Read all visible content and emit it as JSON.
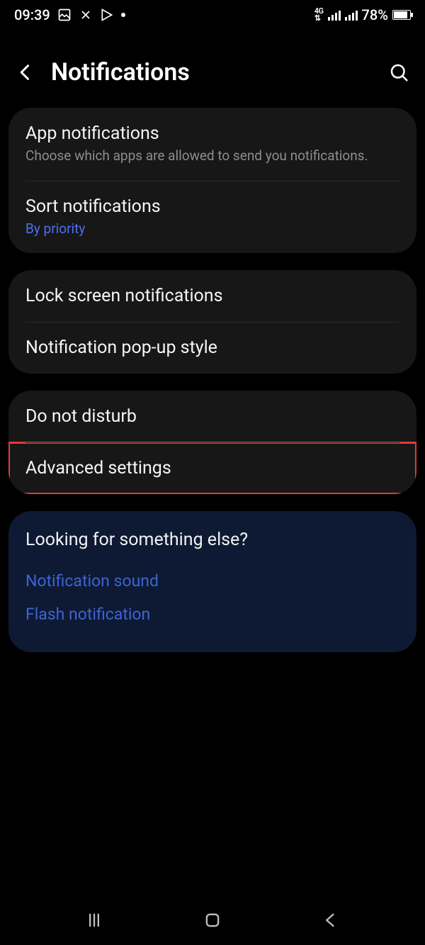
{
  "status": {
    "time": "09:39",
    "network_label": "4G",
    "battery_text": "78%"
  },
  "header": {
    "title": "Notifications"
  },
  "groups": [
    {
      "items": [
        {
          "title": "App notifications",
          "subtitle": "Choose which apps are allowed to send you notifications."
        },
        {
          "title": "Sort notifications",
          "subtitle": "By priority",
          "subtitle_link": true
        }
      ]
    },
    {
      "items": [
        {
          "title": "Lock screen notifications"
        },
        {
          "title": "Notification pop-up style"
        }
      ]
    },
    {
      "items": [
        {
          "title": "Do not disturb"
        },
        {
          "title": "Advanced settings",
          "highlight": true
        }
      ]
    }
  ],
  "looking": {
    "title": "Looking for something else?",
    "links": [
      "Notification sound",
      "Flash notification"
    ]
  }
}
